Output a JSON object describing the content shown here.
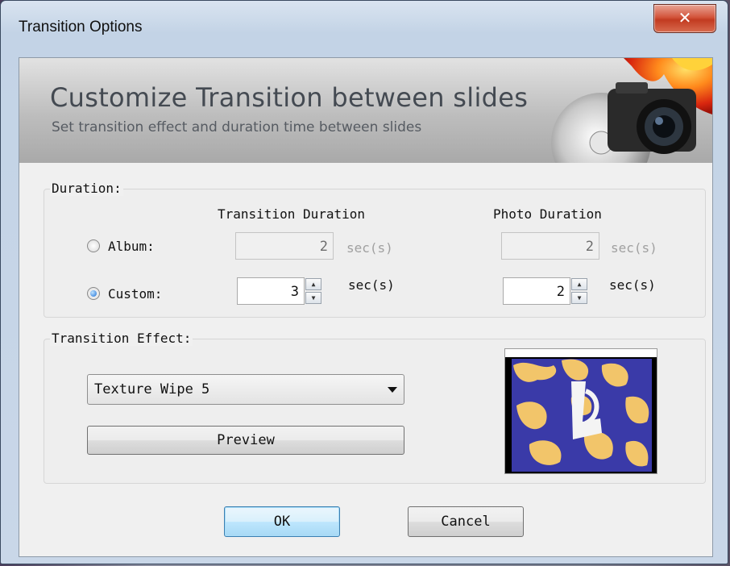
{
  "window": {
    "title": "Transition Options",
    "close_glyph": "✕"
  },
  "banner": {
    "title": "Customize Transition between slides",
    "subtitle": "Set transition effect and duration time between slides"
  },
  "duration": {
    "label": "Duration:",
    "col_transition": "Transition Duration",
    "col_photo": "Photo Duration",
    "album": {
      "label": "Album:",
      "checked": false,
      "transition_value": "2",
      "photo_value": "2",
      "unit": "sec(s)"
    },
    "custom": {
      "label": "Custom:",
      "checked": true,
      "transition_value": "3",
      "photo_value": "2",
      "unit": "sec(s)"
    }
  },
  "effect": {
    "label": "Transition Effect:",
    "selected": "Texture Wipe 5",
    "preview_label": "Preview"
  },
  "buttons": {
    "ok": "OK",
    "cancel": "Cancel"
  },
  "colors": {
    "preview_blue": "#3a3aa8",
    "preview_yellow": "#f2c56a",
    "accent": "#3c7fb1"
  }
}
